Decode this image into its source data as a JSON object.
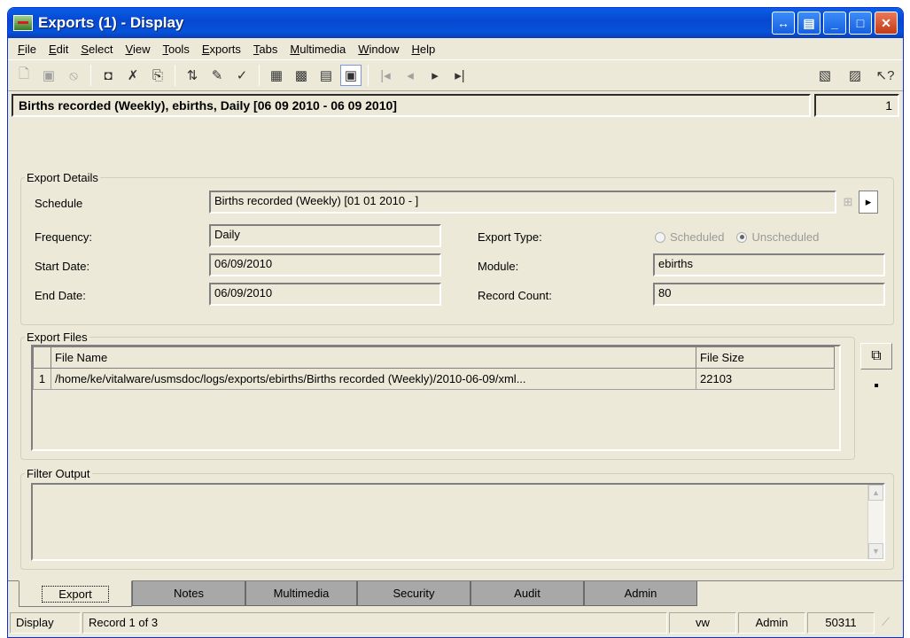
{
  "window": {
    "title": "Exports (1) - Display"
  },
  "menu": [
    "File",
    "Edit",
    "Select",
    "View",
    "Tools",
    "Exports",
    "Tabs",
    "Multimedia",
    "Window",
    "Help"
  ],
  "record": {
    "title": "Births recorded (Weekly), ebirths, Daily [06 09 2010 - 06 09 2010]",
    "number": "1"
  },
  "export_details": {
    "legend": "Export Details",
    "schedule_label": "Schedule",
    "schedule_value": "Births recorded (Weekly) [01 01 2010 - ]",
    "frequency_label": "Frequency:",
    "frequency_value": "Daily",
    "start_label": "Start Date:",
    "start_value": "06/09/2010",
    "end_label": "End Date:",
    "end_value": "06/09/2010",
    "export_type_label": "Export Type:",
    "radio_scheduled": "Scheduled",
    "radio_unscheduled": "Unscheduled",
    "module_label": "Module:",
    "module_value": "ebirths",
    "record_count_label": "Record Count:",
    "record_count_value": "80"
  },
  "export_files": {
    "legend": "Export Files",
    "columns": [
      "File Name",
      "File Size"
    ],
    "rows": [
      {
        "num": "1",
        "file_name": "/home/ke/vitalware/usmsdoc/logs/exports/ebirths/Births recorded (Weekly)/2010-06-09/xml...",
        "file_size": "22103"
      }
    ]
  },
  "filter_output": {
    "legend": "Filter Output"
  },
  "tabs": [
    "Export",
    "Notes",
    "Multimedia",
    "Security",
    "Audit",
    "Admin"
  ],
  "status": {
    "mode": "Display",
    "record": "Record 1 of 3",
    "user1": "vw",
    "user2": "Admin",
    "id": "50311"
  }
}
